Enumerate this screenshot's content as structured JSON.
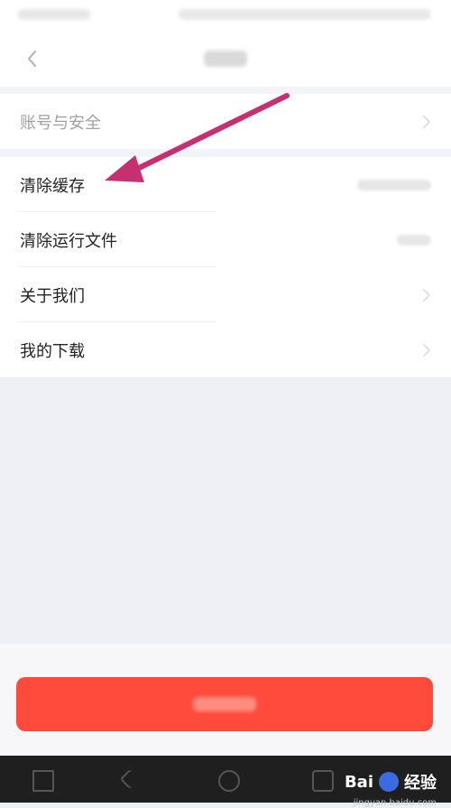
{
  "settings": {
    "items": [
      {
        "label": "账号与安全"
      },
      {
        "label": "清除缓存"
      },
      {
        "label": "清除运行文件"
      },
      {
        "label": "关于我们"
      },
      {
        "label": "我的下载"
      }
    ]
  },
  "watermark": {
    "brand": "Bai",
    "brand_suffix": "经验",
    "site": "jingyan.baidu.com"
  },
  "colors": {
    "accent": "#ff4b3c",
    "arrow": "#c62f70"
  },
  "icons": {
    "back": "back-arrow-icon",
    "chevron": "chevron-right-icon",
    "annotation_arrow": "annotation-arrow-icon"
  }
}
